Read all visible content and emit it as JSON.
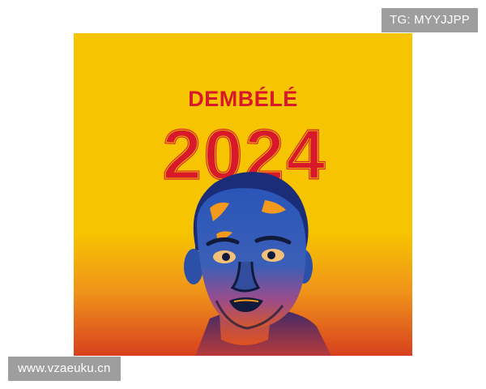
{
  "poster": {
    "player_name": "DEMBÉLÉ",
    "year": "2024",
    "colors": {
      "background_top": "#f6c400",
      "background_bottom": "#e0491e",
      "title_red": "#d7192b",
      "portrait_blue": "#2a4fae",
      "portrait_dark": "#111a3a",
      "portrait_orange": "#f39a1d"
    }
  },
  "watermarks": {
    "telegram": "TG: MYYJJPP",
    "site": "www.vzaeuku.cn"
  }
}
